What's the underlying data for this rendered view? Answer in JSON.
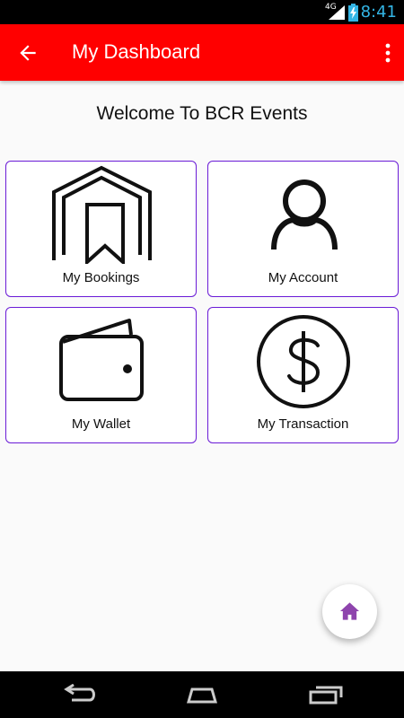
{
  "status_bar": {
    "network": "4G",
    "time": "8:41"
  },
  "app_bar": {
    "title": "My Dashboard",
    "back_icon": "arrow-back-icon",
    "menu_icon": "more-vert-icon",
    "background": "#ff0000"
  },
  "welcome": "Welcome To BCR Events",
  "cards": [
    {
      "label": "My Bookings",
      "icon": "house-bookmark-icon"
    },
    {
      "label": "My Account",
      "icon": "person-icon"
    },
    {
      "label": "My Wallet",
      "icon": "wallet-icon"
    },
    {
      "label": "My Transaction",
      "icon": "dollar-circle-icon"
    }
  ],
  "fab": {
    "icon": "home-icon",
    "color": "#8e44ad"
  },
  "nav_bar": {
    "back": "back-nav-icon",
    "home": "home-nav-icon",
    "recents": "recents-nav-icon"
  },
  "colors": {
    "accent": "#ff0000",
    "card_border": "#6a1bd6",
    "status_clock": "#33b5e5"
  }
}
